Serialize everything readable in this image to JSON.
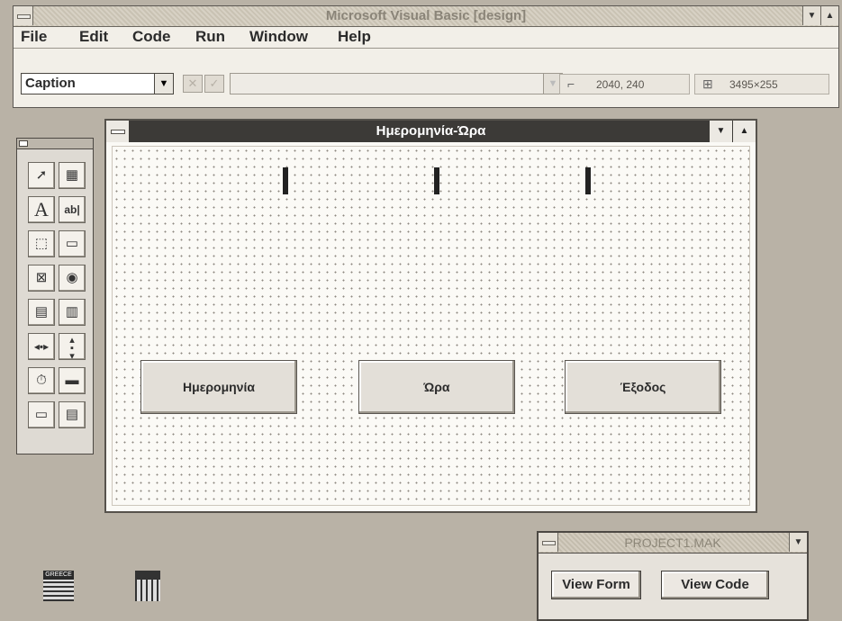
{
  "app": {
    "title": "Microsoft Visual Basic [design]",
    "menu": [
      "File",
      "Edit",
      "Code",
      "Run",
      "Window",
      "Help"
    ],
    "property_combo": "Caption",
    "position_readout": "2040, 240",
    "size_readout": "3495×255"
  },
  "form": {
    "title": "Ημερομηνία-Ώρα",
    "buttons": [
      "Ημερομηνία",
      "Ώρα",
      "Έξοδος"
    ]
  },
  "toolbox": {
    "tools": [
      "pointer-icon",
      "picture-box-icon",
      "label-icon",
      "text-box-icon",
      "frame-icon",
      "command-button-icon",
      "check-box-icon",
      "option-button-icon",
      "combo-box-icon",
      "list-box-icon",
      "hscroll-icon",
      "vscroll-icon",
      "timer-icon",
      "drive-list-icon",
      "dir-list-icon",
      "file-list-icon"
    ]
  },
  "project": {
    "title": "PROJECT1.MAK",
    "view_form": "View Form",
    "view_code": "View Code"
  },
  "desktop": {
    "icon1_label": "GREECE"
  }
}
